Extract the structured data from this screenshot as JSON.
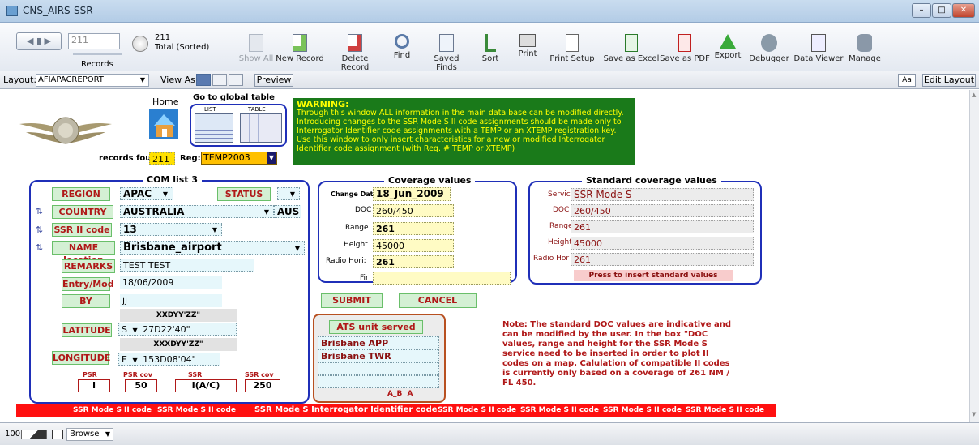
{
  "window": {
    "title": "CNS_AIRS-SSR"
  },
  "toolbar": {
    "record_current": "211",
    "records_label": "Records",
    "total_count": "211",
    "total_label": "Total (Sorted)",
    "buttons": [
      "Show All",
      "New Record",
      "Delete Record",
      "Find",
      "Saved Finds",
      "Sort",
      "Print",
      "Print Setup",
      "Save as Excel",
      "Save as PDF",
      "Export",
      "Debugger",
      "Data Viewer",
      "Manage"
    ]
  },
  "layoutbar": {
    "layout_label": "Layout:",
    "layout_value": "AFIAPACREPORT",
    "view_as_label": "View As:",
    "preview_label": "Preview",
    "font_size_label": "Aa",
    "edit_layout_label": "Edit Layout"
  },
  "header": {
    "home_label": "Home",
    "global_table_label": "Go to global table",
    "list_label": "LIST",
    "table_label": "TABLE",
    "records_found_label": "records found",
    "records_found_value": "211",
    "reg_label": "Reg:",
    "reg_value": "TEMP2003",
    "warning_title": "WARNING:",
    "warning_text": "Through this window ALL information in the main data base can be modified directly. Introducing changes to the SSR Mode S II code assignments should be made only to Interrogator Identifier code assignments with a TEMP or an XTEMP registration key. Use this window to only insert characteristics for a new or modified Interrogator Identifier code assignment (with Reg. # TEMP or XTEMP)"
  },
  "com_list": {
    "title": "COM list 3",
    "region_label": "REGION",
    "region_value": "APAC",
    "status_label": "STATUS",
    "status_value": "",
    "country_label": "COUNTRY",
    "country_value": "AUSTRALIA",
    "country_code": "AUS",
    "ssr_code_label": "SSR II code",
    "ssr_code_value": "13",
    "name_location_label": "NAME location",
    "name_location_value": "Brisbane_airport",
    "remarks_label": "REMARKS",
    "remarks_value": "TEST TEST",
    "entry_label": "Entry/Mod",
    "entry_value": "18/06/2009",
    "by_label": "BY",
    "by_value": "jj",
    "lat_format": "XXDYY'ZZ\"",
    "latitude_label": "LATITUDE",
    "lat_hemi": "S",
    "lat_value": "27D22'40\"",
    "lon_format": "XXXDYY'ZZ\"",
    "longitude_label": "LONGITUDE",
    "lon_hemi": "E",
    "lon_value": "153D08'04\"",
    "psr_label": "PSR",
    "psr_value": "I",
    "psr_cov_label": "PSR cov",
    "psr_cov_value": "50",
    "ssr_label": "SSR",
    "ssr_value": "I(A/C)",
    "ssr_cov_label": "SSR cov",
    "ssr_cov_value": "250"
  },
  "coverage": {
    "title": "Coverage values",
    "change_date_label": "Change Date",
    "change_date_value": "18_Jun_2009",
    "doc_label": "DOC",
    "doc_value": "260/450",
    "range_label": "Range",
    "range_value": "261",
    "height_label": "Height",
    "height_value": "45000",
    "radio_label": "Radio Hori:",
    "radio_value": "261",
    "fir_label": "Fir",
    "fir_value": ""
  },
  "standard": {
    "title": "Standard coverage values",
    "service_label": "Service",
    "service_value": "SSR Mode S",
    "doc_label": "DOC",
    "doc_value": "260/450",
    "range_label": "Range",
    "range_value": "261",
    "height_label": "Height",
    "height_value": "45000",
    "radio_label": "Radio Hor",
    "radio_value": "261",
    "insert_label": "Press to insert standard values"
  },
  "actions": {
    "submit_label": "SUBMIT",
    "cancel_label": "CANCEL"
  },
  "ats": {
    "title": "ATS unit served",
    "units": [
      "Brisbane APP",
      "Brisbane TWR",
      "",
      ""
    ],
    "footer": "A_B",
    "footer2": "A"
  },
  "note": {
    "text": "Note: The standard DOC values are indicative and can be modified by the user. In the box \"DOC values, range and height for the SSR Mode S service need to be inserted in order to plot II codes on a map. Calulation of compatible II codes is currently only based on a coverage of 261 NM / FL 450."
  },
  "redbar": [
    "SSR Mode S II code",
    "SSR Mode S II code",
    "SSR Mode S Interrogator Identifier code",
    "SSR Mode S II code",
    "SSR Mode S II code",
    "SSR Mode S II code",
    "SSR Mode S II code"
  ],
  "statusbar": {
    "zoom": "100",
    "mode": "Browse"
  },
  "colors": {
    "accent_blue": "#1f2fb8",
    "label_green": "#d4f0d4",
    "warning_green": "#1a7a1a",
    "warning_text": "#ffff00",
    "red_bar": "#ff1010"
  }
}
